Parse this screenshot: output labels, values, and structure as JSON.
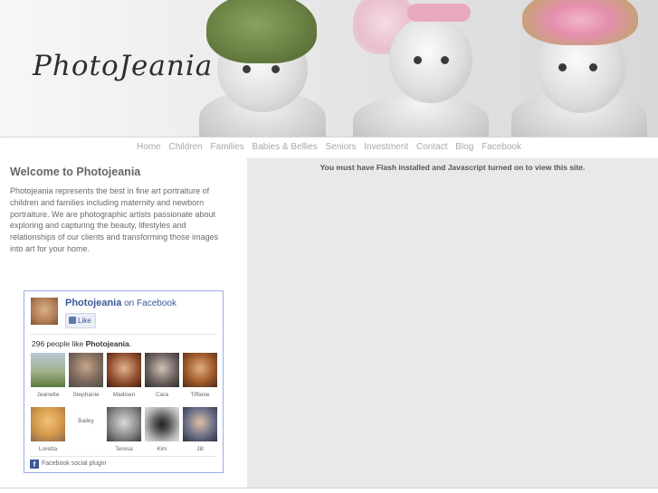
{
  "site": {
    "logo_text": "PhotoJeania"
  },
  "nav": {
    "items": [
      {
        "label": "Home"
      },
      {
        "label": "Children"
      },
      {
        "label": "Families"
      },
      {
        "label": "Babies & Bellies"
      },
      {
        "label": "Seniors"
      },
      {
        "label": "Investment"
      },
      {
        "label": "Contact"
      },
      {
        "label": "Blog"
      },
      {
        "label": "Facebook"
      }
    ]
  },
  "welcome": {
    "title": "Welcome to Photojeania",
    "body": "Photojeania represents the best in fine art portraiture of children and families including maternity and newborn portraiture.  We are photographic artists passionate about exploring and capturing the beauty, lifestyles and relationships of our clients and transforming those images into art for your home."
  },
  "facebook": {
    "page_name": "Photojeania",
    "on_facebook": "on Facebook",
    "like_label": "Like",
    "count_prefix": "296 people like",
    "count_page": "Photojeania",
    "count_suffix": ".",
    "friends": [
      {
        "name": "Jeanette"
      },
      {
        "name": "Stephanie"
      },
      {
        "name": "Madisen"
      },
      {
        "name": "Cara"
      },
      {
        "name": "Tiffanie"
      },
      {
        "name": "Loretta"
      },
      {
        "name": "Bailey"
      },
      {
        "name": "Teresa"
      },
      {
        "name": "Kim"
      },
      {
        "name": "Jill"
      }
    ],
    "plugin_label": "Facebook social plugin"
  },
  "flash_notice": "You must have Flash installed and Javascript turned on to view this site."
}
